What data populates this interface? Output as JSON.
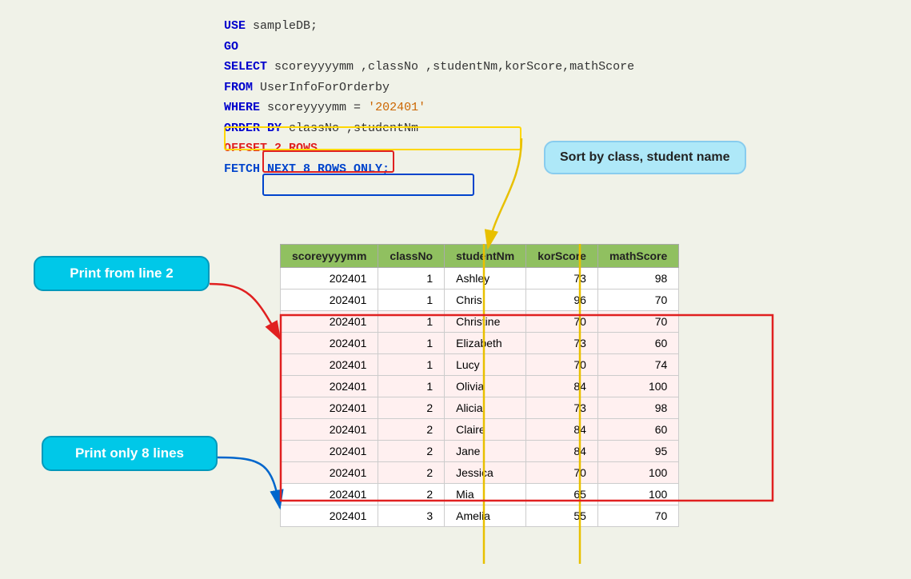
{
  "sql": {
    "line1": "USE sampleDB;",
    "line2": "GO",
    "line3": "SELECT  scoreyyyymm ,classNo   ,studentNm,korScore,mathScore",
    "line4": "FROM  UserInfoForOrderby",
    "line5_pre": "WHERE  scoreyyyymm = ",
    "line5_str": "'202401'",
    "line6": "ORDER BY  classNo   ,studentNm",
    "line7": "  OFFSET 2 ROWS",
    "line8": "  FETCH NEXT 8 ROWS ONLY;"
  },
  "tooltips": {
    "sort": "Sort by class, student name",
    "line2": "Print from line 2",
    "8lines": "Print only 8 lines"
  },
  "table": {
    "headers": [
      "scoreyyyymm",
      "classNo",
      "studentNm",
      "korScore",
      "mathScore"
    ],
    "rows": [
      [
        "202401",
        "1",
        "Ashley",
        "73",
        "98"
      ],
      [
        "202401",
        "1",
        "Chris",
        "96",
        "70"
      ],
      [
        "202401",
        "1",
        "Christine",
        "70",
        "70"
      ],
      [
        "202401",
        "1",
        "Elizabeth",
        "73",
        "60"
      ],
      [
        "202401",
        "1",
        "Lucy",
        "70",
        "74"
      ],
      [
        "202401",
        "1",
        "Olivia",
        "84",
        "100"
      ],
      [
        "202401",
        "2",
        "Alicia",
        "73",
        "98"
      ],
      [
        "202401",
        "2",
        "Claire",
        "84",
        "60"
      ],
      [
        "202401",
        "2",
        "Jane",
        "84",
        "95"
      ],
      [
        "202401",
        "2",
        "Jessica",
        "70",
        "100"
      ],
      [
        "202401",
        "2",
        "Mia",
        "65",
        "100"
      ],
      [
        "202401",
        "3",
        "Amelia",
        "55",
        "70"
      ]
    ]
  }
}
